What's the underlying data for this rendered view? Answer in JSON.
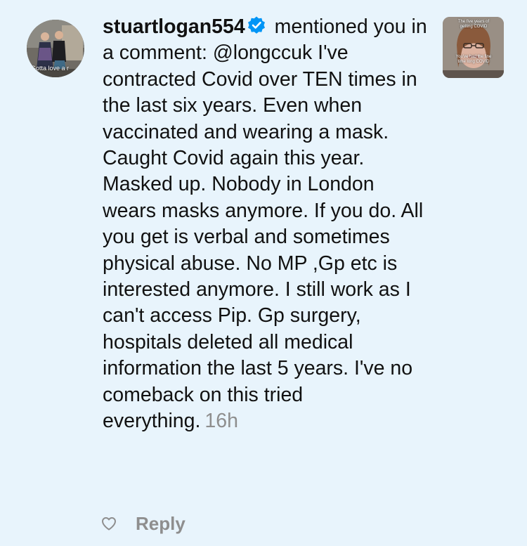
{
  "notification": {
    "username": "stuartlogan554",
    "verified": true,
    "action_text": "mentioned you in a comment:",
    "mention": "@longccuk",
    "comment_text": "I've contracted Covid over TEN times in the last six years. Even when vaccinated and wearing a mask. Caught Covid again this year. Masked up. Nobody in London wears masks anymore. If you do. All you get is verbal and sometimes physical abuse. No MP ,Gp etc is interested anymore. I still work as I can't access Pip. Gp surgery, hospitals deleted all medical information the last 5 years. I've no comeback on this tried everything.",
    "timestamp": "16h",
    "avatar_caption": "Gotta love a r",
    "thumbnail": {
      "top_caption": "The five years of getting COVID",
      "bottom_caption": "You've had the fine time long COVID"
    }
  },
  "actions": {
    "like_icon": "heart-outline-icon",
    "reply_label": "Reply"
  },
  "colors": {
    "background": "#e8f4fc",
    "text": "#111111",
    "muted": "#8e8e8e",
    "verified_badge": "#0095f6"
  }
}
